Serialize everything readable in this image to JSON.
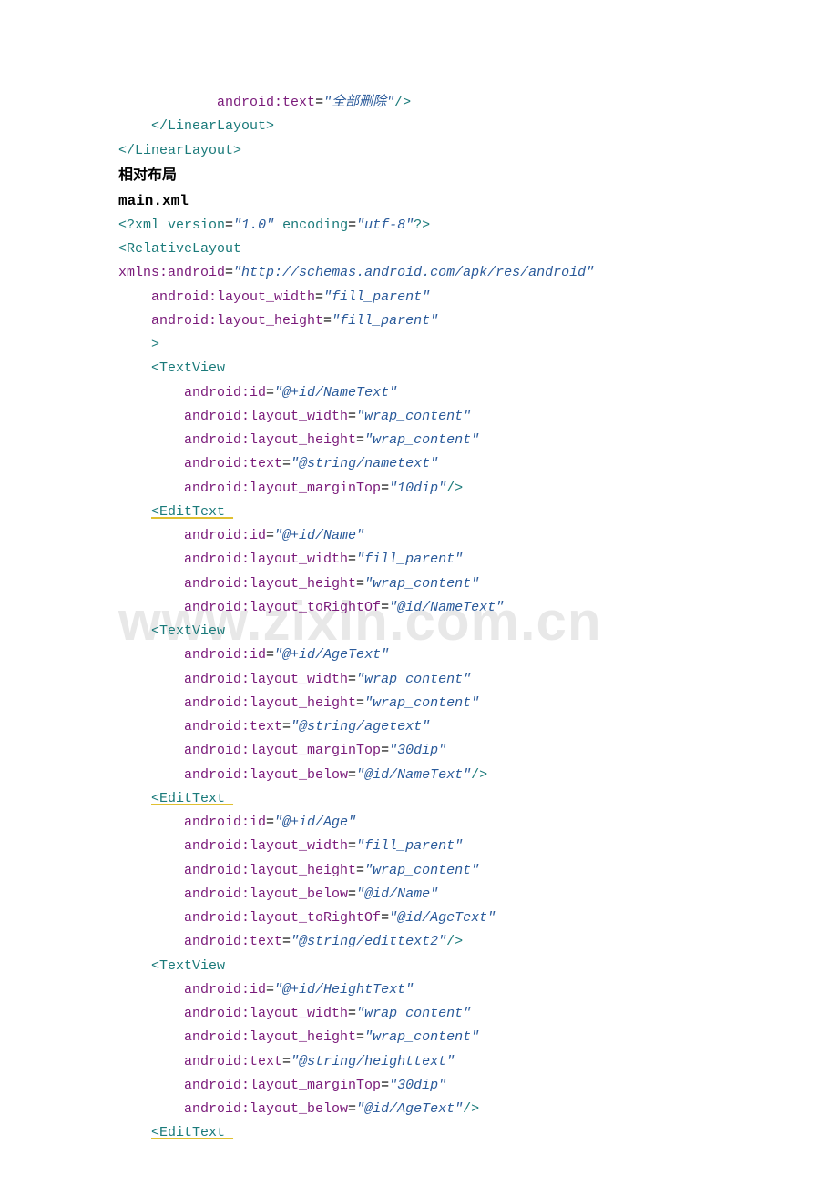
{
  "watermark": "www.zixin.com.cn",
  "lines": {
    "l1_indent": "            ",
    "l1_attr": "android:text",
    "l1_val": "\"全部删除\"",
    "l1_close": "/>",
    "l2": "    </LinearLayout>",
    "l3": "</LinearLayout>",
    "l4": "相对布局",
    "l5": "main.xml",
    "l6_a": "<?",
    "l6_b": "xml version",
    "l6_c": "=",
    "l6_d": "\"1.0\"",
    "l6_e": " encoding",
    "l6_f": "=",
    "l6_g": "\"utf-8\"",
    "l6_h": "?>",
    "l7": "<RelativeLayout",
    "l8_a": "xmlns:android",
    "l8_b": "=",
    "l8_c": "\"http://schemas.android.com/apk/res/android\"",
    "l9_i": "    ",
    "l9_a": "android:layout_width",
    "l9_b": "=",
    "l9_c": "\"fill_parent\"",
    "l10_a": "android:layout_height",
    "l10_c": "\"fill_parent\"",
    "l11": "    >",
    "l12": "    <TextView",
    "l13_i": "        ",
    "l13_a": "android:id",
    "l13_c": "\"@+id/NameText\"",
    "l14_a": "android:layout_width",
    "l14_c": "\"wrap_content\"",
    "l15_a": "android:layout_height",
    "l15_c": "\"wrap_content\"",
    "l16_a": "android:text",
    "l16_c": "\"@string/nametext\"",
    "l17_a": "android:layout_marginTop",
    "l17_c": "\"10dip\"",
    "l17_close": "/>",
    "l18_i": "    ",
    "l18_a": "<EditText ",
    "l19_a": "android:id",
    "l19_c": "\"@+id/Name\"",
    "l20_a": "android:layout_width",
    "l20_c": "\"fill_parent\"",
    "l21_a": "android:layout_height",
    "l21_c": "\"wrap_content\"",
    "l22_a": "android:layout_toRightOf",
    "l22_c": "\"@id/NameText\"",
    "l23": "    <TextView",
    "l24_a": "android:id",
    "l24_c": "\"@+id/AgeText\"",
    "l25_a": "android:layout_width",
    "l25_c": "\"wrap_content\"",
    "l26_a": "android:layout_height",
    "l26_c": "\"wrap_content\"",
    "l27_a": "android:text",
    "l27_c": "\"@string/agetext\"",
    "l28_a": "android:layout_marginTop",
    "l28_c": "\"30dip\"",
    "l29_a": "android:layout_below",
    "l29_c": "\"@id/NameText\"",
    "l29_close": "/>",
    "l30_a": "<EditText ",
    "l31_a": "android:id",
    "l31_c": "\"@+id/Age\"",
    "l32_a": "android:layout_width",
    "l32_c": "\"fill_parent\"",
    "l33_a": "android:layout_height",
    "l33_c": "\"wrap_content\"",
    "l34_a": "android:layout_below",
    "l34_c": "\"@id/Name\"",
    "l35_a": "android:layout_toRightOf",
    "l35_c": "\"@id/AgeText\"",
    "l36_a": "android:text",
    "l36_c": "\"@string/edittext2\"",
    "l36_close": "/>",
    "l37": "    <TextView",
    "l38_a": "android:id",
    "l38_c": "\"@+id/HeightText\"",
    "l39_a": "android:layout_width",
    "l39_c": "\"wrap_content\"",
    "l40_a": "android:layout_height",
    "l40_c": "\"wrap_content\"",
    "l41_a": "android:text",
    "l41_c": "\"@string/heighttext\"",
    "l42_a": "android:layout_marginTop",
    "l42_c": "\"30dip\"",
    "l43_a": "android:layout_below",
    "l43_c": "\"@id/AgeText\"",
    "l43_close": "/>",
    "l44_a": "<EditText "
  }
}
